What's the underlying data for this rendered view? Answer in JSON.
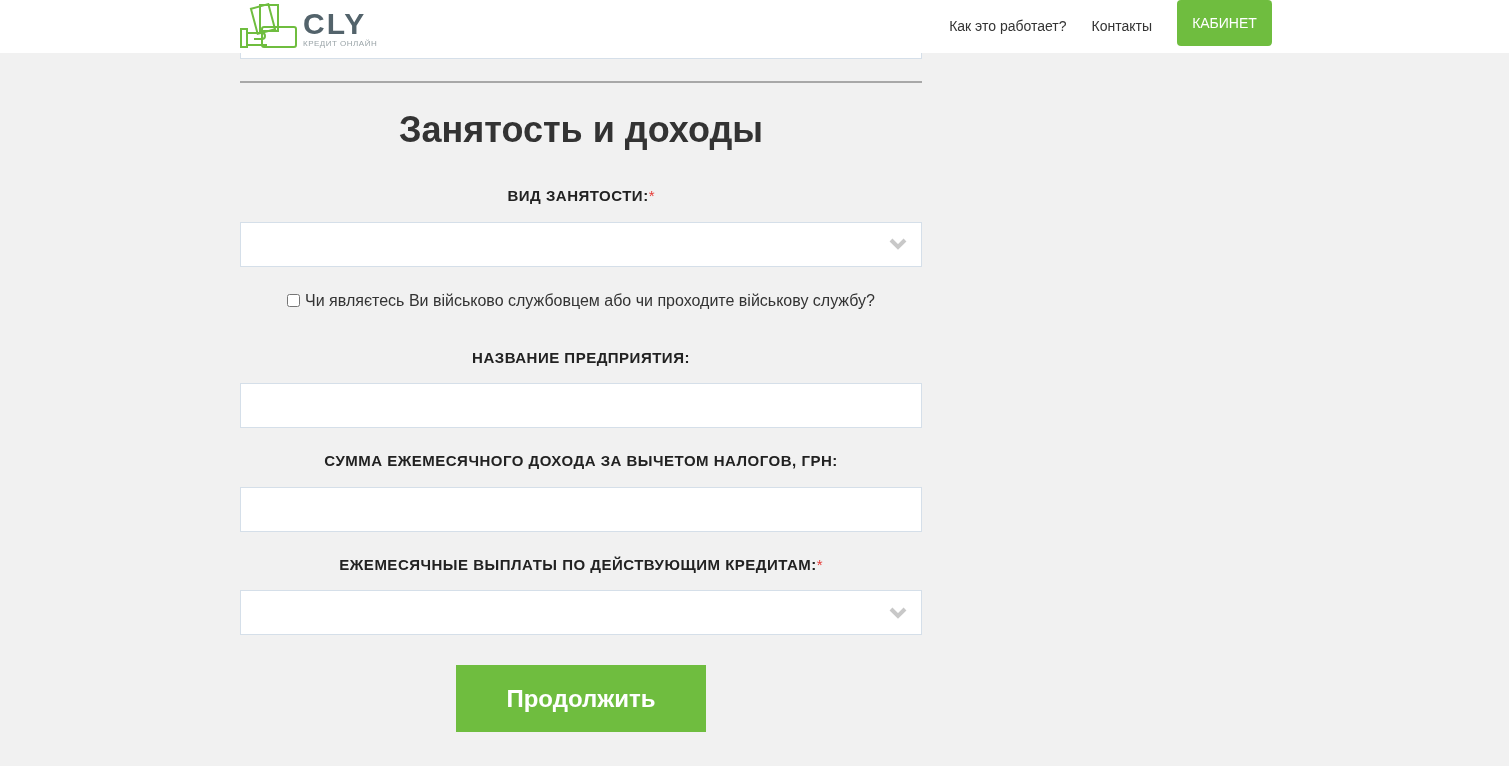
{
  "header": {
    "logo": {
      "name": "CLY",
      "tagline": "КРЕДИТ ОНЛАЙН"
    },
    "nav": [
      {
        "label": "Как это работает?"
      },
      {
        "label": "Контакты"
      }
    ],
    "cabinet_button": "КАБИНЕТ"
  },
  "section": {
    "title": "Занятость и доходы",
    "fields": [
      {
        "kind": "select",
        "label": "ВИД ЗАНЯТОСТИ:",
        "required_mark": "*"
      },
      {
        "kind": "checkbox",
        "label": "Чи являєтесь Ви військово службовцем або чи проходите військову службу?",
        "checked": false
      },
      {
        "kind": "input",
        "label": "НАЗВАНИЕ ПРЕДПРИЯТИЯ:"
      },
      {
        "kind": "input",
        "label": "СУММА ЕЖЕМЕСЯЧНОГО ДОХОДА ЗА ВЫЧЕТОМ НАЛОГОВ, ГРН:"
      },
      {
        "kind": "select",
        "label": "ЕЖЕМЕСЯЧНЫЕ ВЫПЛАТЫ ПО ДЕЙСТВУЮЩИМ КРЕДИТАМ:",
        "required_mark": "*"
      }
    ],
    "submit": "Продолжить"
  }
}
